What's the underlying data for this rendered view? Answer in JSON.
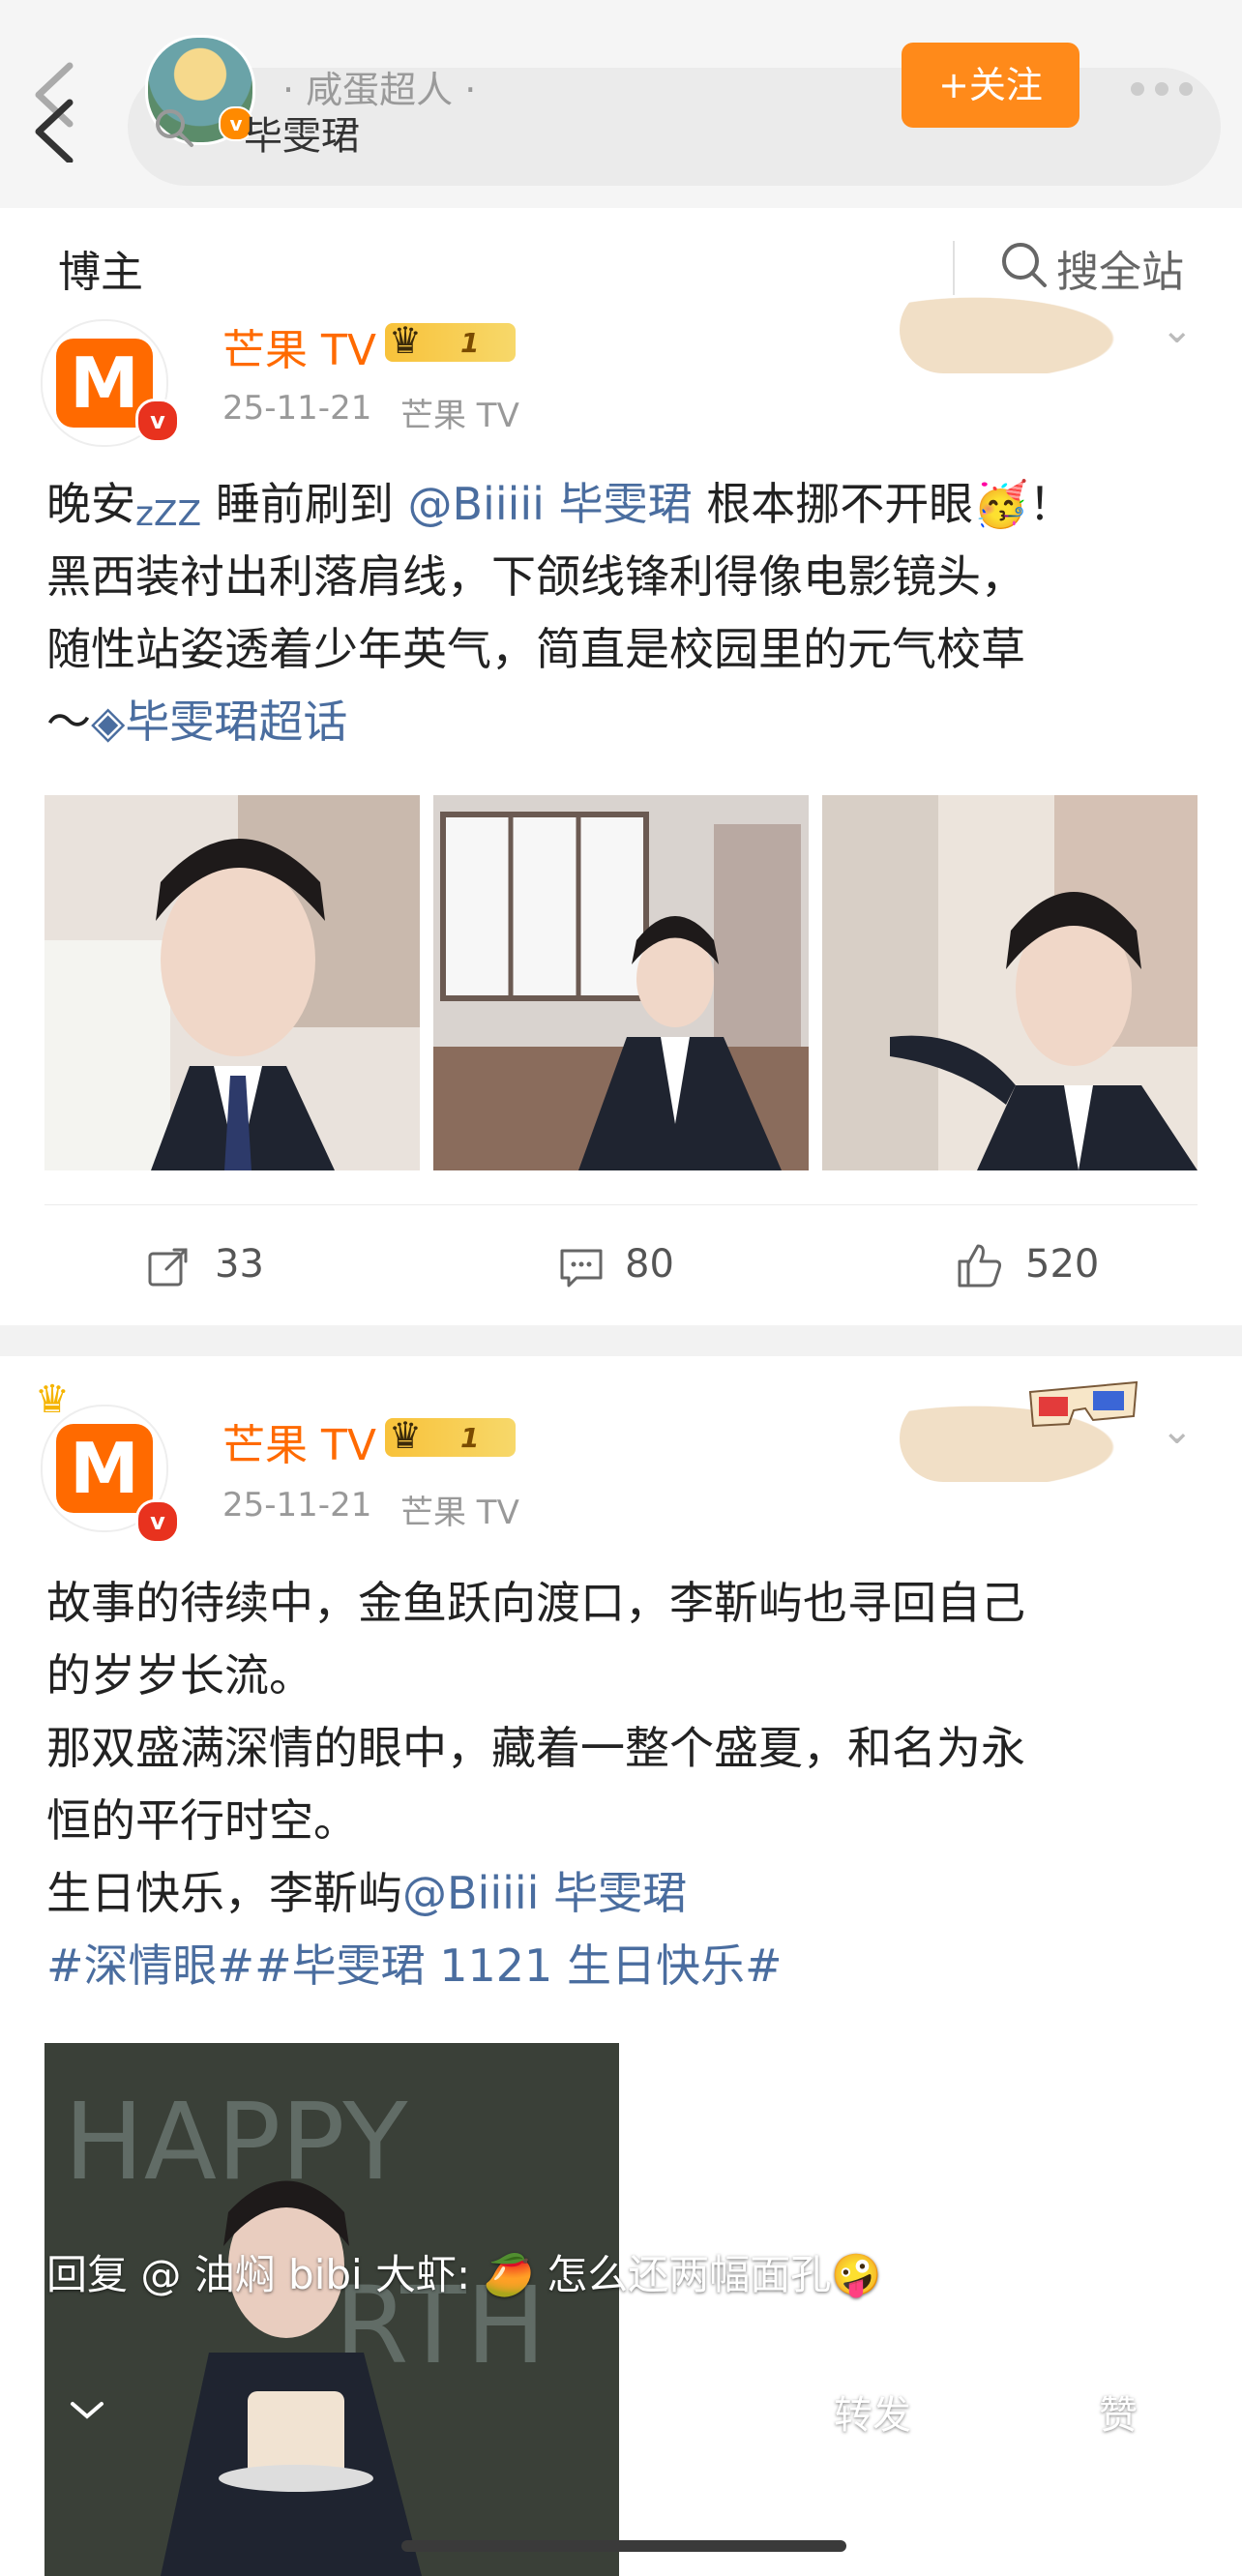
{
  "header": {
    "fan_name": "· 咸蛋超人 ·",
    "search_term": "毕雯珺",
    "follow_label": "+关注"
  },
  "filter": {
    "tab_label": "博主",
    "site_search_label": "搜全站"
  },
  "posts": [
    {
      "account": "芒果 TV",
      "vip_level": "1",
      "date": "25-11-21",
      "source": "芒果 TV",
      "text_lines": [
        {
          "pre": "晚安",
          "zzz": "zZZ",
          "mid": " 睡前刷到 ",
          "link": "@Biiiii 毕雯珺",
          "post": " 根本挪不开眼🥳！"
        },
        "黑西装衬出利落肩线，下颌线锋利得像电影镜头，",
        "随性站姿透着少年英气，简直是校园里的元气校草"
      ],
      "tail": "～",
      "topic": "毕雯珺超话",
      "repost_count": "33",
      "comment_count": "80",
      "like_count": "520"
    },
    {
      "account": "芒果 TV",
      "vip_level": "1",
      "date": "25-11-21",
      "source": "芒果 TV",
      "text_lines": [
        "故事的待续中，金鱼跃向渡口，李靳屿也寻回自己",
        "的岁岁长流。",
        "那双盛满深情的眼中，藏着一整个盛夏，和名为永",
        "恒的平行时空。"
      ],
      "birthday_pre": "生日快乐，李靳屿",
      "birthday_link": "@Biiiii 毕雯珺",
      "hashtags": "#深情眼##毕雯珺 1121 生日快乐#"
    }
  ],
  "overlay": {
    "reply_text": "回复 @ 油焖 bibi 大虾: 🥭 怎么还两幅面孔🤪",
    "repost_label": "转发",
    "like_label": "赞"
  },
  "colors": {
    "brand_orange": "#ff6a00",
    "follow_orange": "#ff8a1a",
    "link_blue": "#4a6d9f"
  }
}
